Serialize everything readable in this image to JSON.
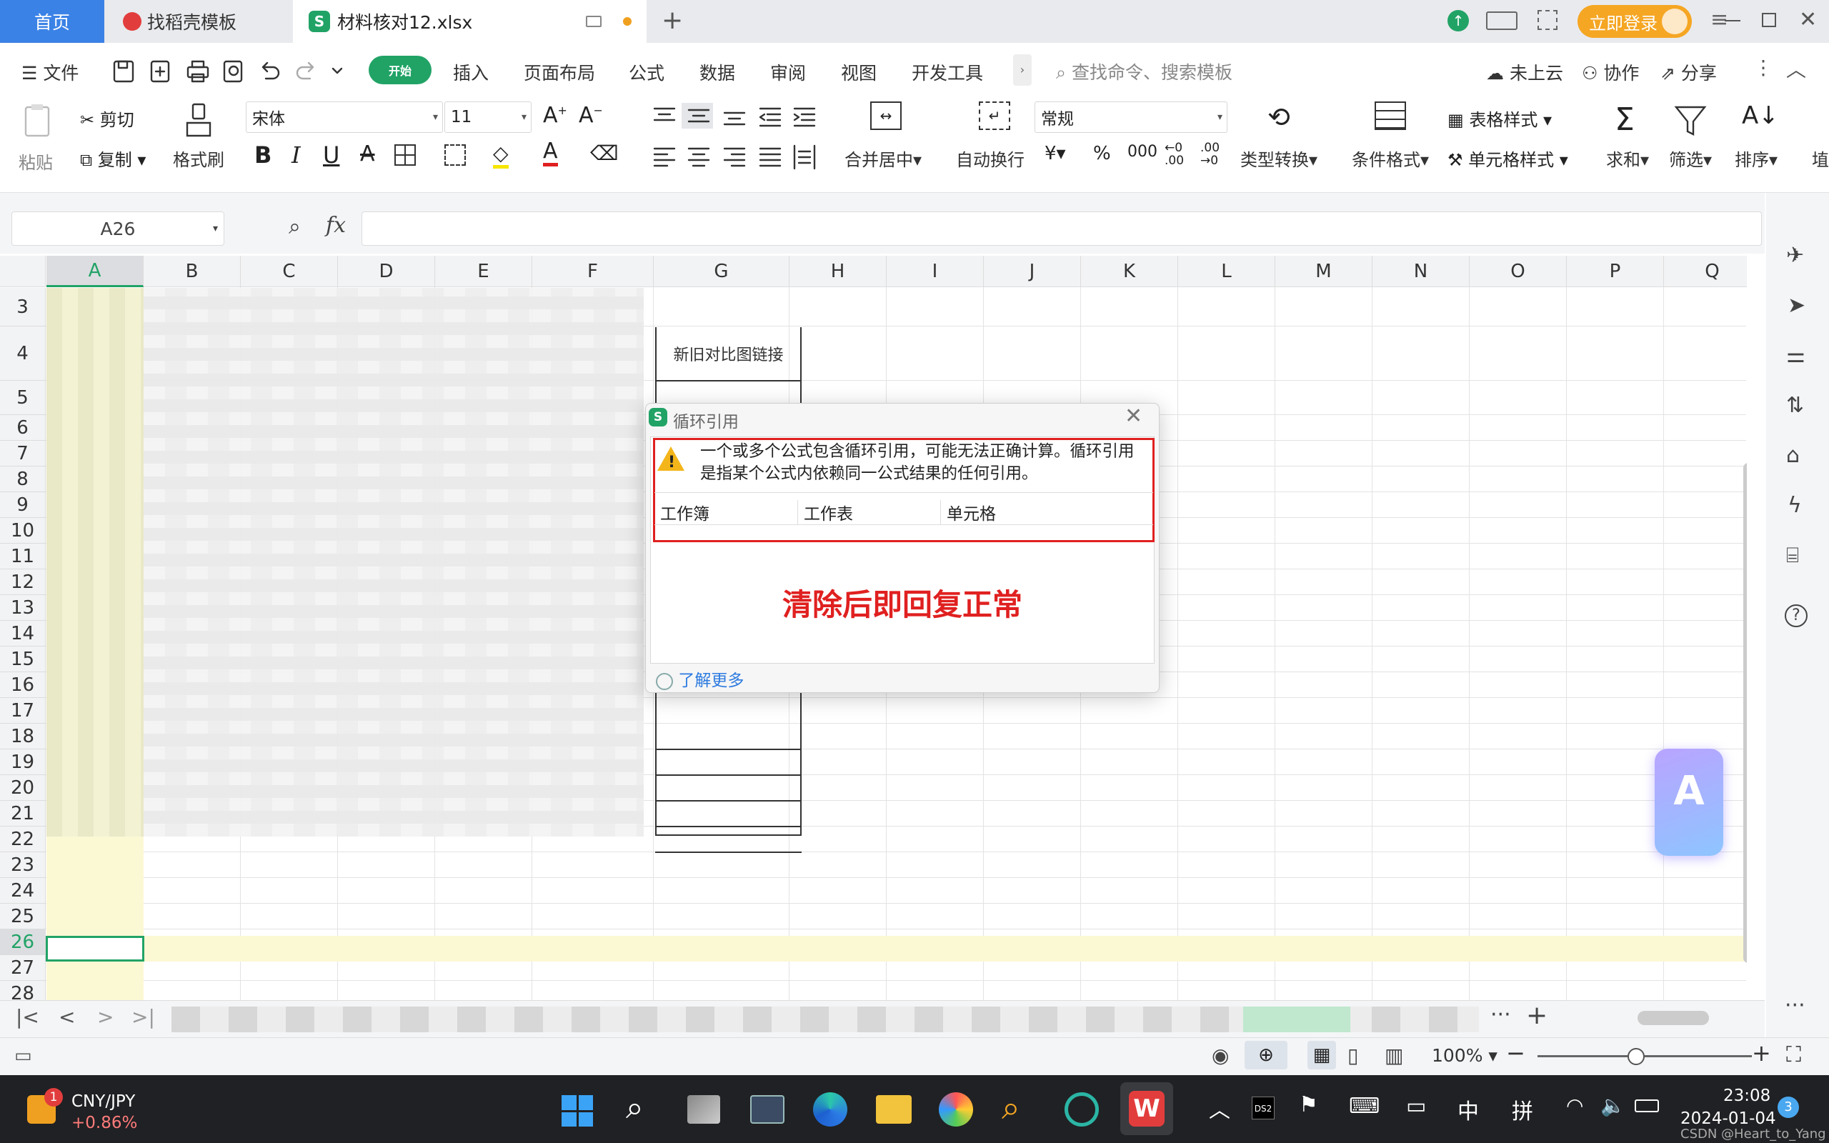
{
  "tabs": {
    "home": "首页",
    "find_template": "找稻壳模板",
    "file": "材料核对12.xlsx"
  },
  "titlebar": {
    "login": "立即登录"
  },
  "menu": {
    "file": "文件",
    "items": [
      "开始",
      "插入",
      "页面布局",
      "公式",
      "数据",
      "审阅",
      "视图",
      "开发工具"
    ],
    "search_placeholder": "查找命令、搜索模板",
    "cloud": "未上云",
    "collab": "协作",
    "share": "分享"
  },
  "ribbon": {
    "paste": "粘贴",
    "cut": "剪切",
    "copy": "复制",
    "format_painter": "格式刷",
    "font_name": "宋体",
    "font_size": "11",
    "merge_center": "合并居中",
    "wrap_text": "自动换行",
    "number_format": "常规",
    "type_convert": "类型转换",
    "conditional_format": "条件格式",
    "table_style": "表格样式",
    "cell_style": "单元格样式",
    "sum": "求和",
    "filter": "筛选",
    "sort": "排序",
    "fill_partial": "埴"
  },
  "formula": {
    "cell_ref": "A26",
    "fx": "fx"
  },
  "sheet": {
    "columns": [
      "A",
      "B",
      "C",
      "D",
      "E",
      "F",
      "G",
      "H",
      "I",
      "J",
      "K",
      "L",
      "M",
      "N",
      "O",
      "P",
      "Q"
    ],
    "rows": [
      "3",
      "4",
      "5",
      "6",
      "7",
      "8",
      "9",
      "10",
      "11",
      "12",
      "13",
      "14",
      "15",
      "16",
      "17",
      "18",
      "19",
      "20",
      "21",
      "22",
      "23",
      "24",
      "25",
      "26",
      "27",
      "28"
    ],
    "g4_text": "新旧对比图链接"
  },
  "dialog": {
    "title": "循环引用",
    "message": "一个或多个公式包含循环引用，可能无法正确计算。循环引用是指某个公式内依赖同一公式结果的任何引用。",
    "col_workbook": "工作簿",
    "col_sheet": "工作表",
    "col_cell": "单元格",
    "annotation": "清除后即回复正常",
    "learn_more": "了解更多"
  },
  "status": {
    "zoom": "100%"
  },
  "taskbar": {
    "ticker": "CNY/JPY",
    "change": "+0.86%",
    "badge": "1",
    "ime": "中",
    "pinyin": "拼",
    "time": "23:08",
    "date": "2024-01-04",
    "notif": "3",
    "watermark": "CSDN @Heart_to_Yang"
  },
  "colors": {
    "accent": "#21a366",
    "home_tab": "#3b82e6",
    "login": "#f5a623",
    "dialog_annotation": "#e02020"
  }
}
